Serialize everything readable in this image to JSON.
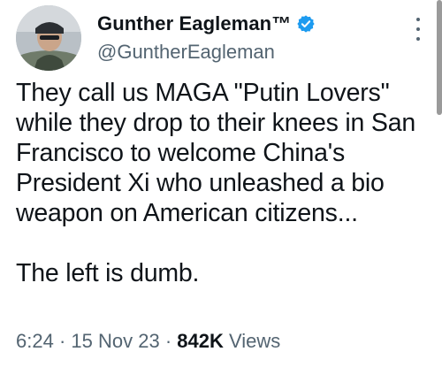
{
  "author": {
    "display_name": "Gunther Eagleman™",
    "handle": "@GuntherEagleman",
    "verified": true,
    "verified_color": "#1d9bf0"
  },
  "tweet": {
    "paragraphs": [
      "They call us MAGA \"Putin Lovers\" while they drop to their knees in San Francisco to welcome China's President Xi who unleashed a bio weapon on American citizens...",
      "The left is dumb."
    ],
    "time": "6:24",
    "separator": "·",
    "date": "15 Nov 23",
    "views_count": "842K",
    "views_label": "Views"
  },
  "icons": {
    "more": "more-vertical-icon",
    "verified": "verified-badge-icon"
  }
}
